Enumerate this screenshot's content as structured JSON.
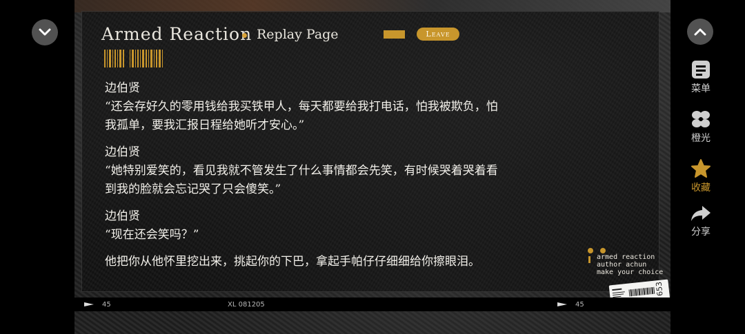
{
  "header": {
    "title": "Armed  Reaction",
    "subtitle": "Replay Page",
    "leave_label": "Leave"
  },
  "dialogue": [
    {
      "speaker": "边伯贤",
      "lines": [
        "“还会存好久的零用钱给我买铁甲人，每天都要给我打电话，怕我被欺负，怕",
        "我孤单，要我汇报日程给她听才安心。”"
      ]
    },
    {
      "speaker": "边伯贤",
      "lines": [
        "“她特别爱笑的，看见我就不管发生了什么事情都会先笑，有时候哭着哭着看",
        "到我的脸就会忘记哭了只会傻笑。”"
      ]
    },
    {
      "speaker": "边伯贤",
      "lines": [
        "“现在还会笑吗？”"
      ]
    },
    {
      "speaker": "",
      "lines": [
        "他把你从他怀里挖出来，挑起你的下巴，拿起手帕仔仔细细给你擦眼泪。"
      ]
    }
  ],
  "credit": {
    "line1": "armed reaction",
    "line2": "author achun",
    "line3": "make your choice"
  },
  "footer": {
    "left_number": "45",
    "center_code": "XL 081205",
    "right_number": "45"
  },
  "ticket": {
    "text": "653"
  },
  "side_menu": [
    {
      "label": "菜单",
      "icon": "menu-icon",
      "color": "#cfcfcf"
    },
    {
      "label": "橙光",
      "icon": "orange-light-icon",
      "color": "#cfcfcf"
    },
    {
      "label": "收藏",
      "icon": "star-icon",
      "color": "#c8962c"
    },
    {
      "label": "分享",
      "icon": "share-icon",
      "color": "#cfcfcf"
    }
  ],
  "colors": {
    "accent": "#c8962c",
    "text": "#f2f0ea"
  }
}
